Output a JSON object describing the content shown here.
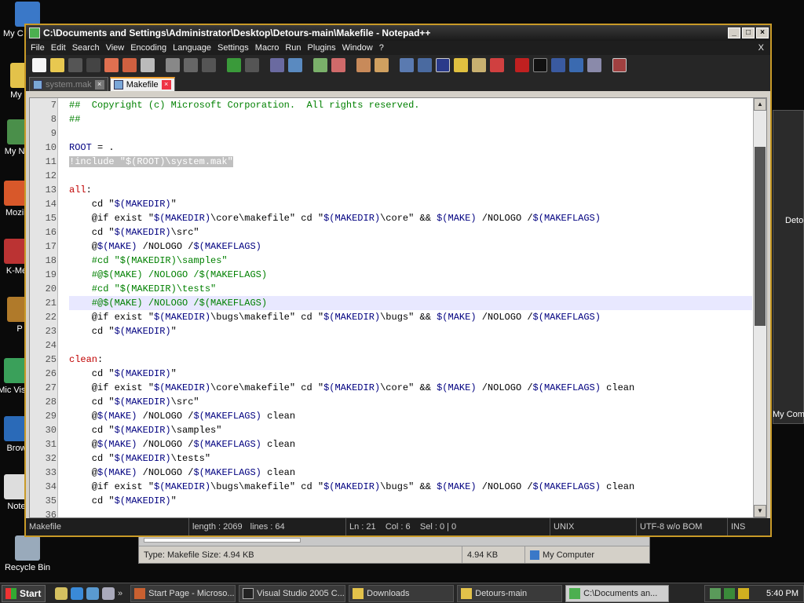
{
  "desktop": {
    "icons": [
      {
        "label": "My C"
      },
      {
        "label": "My Do"
      },
      {
        "label": "My N Pl"
      },
      {
        "label": "Mozill"
      },
      {
        "label": "K-Me"
      },
      {
        "label": "P"
      },
      {
        "label": "Mic Visua"
      },
      {
        "label": "Brow"
      },
      {
        "label": "Note"
      },
      {
        "label": "Recycle Bin"
      }
    ],
    "bg_right_labels": [
      "Deto",
      "My Comp"
    ]
  },
  "bg_explorer": {
    "status_type": "Type: Makefile Size: 4.94 KB",
    "status_size": "4.94 KB",
    "status_location": "My Computer"
  },
  "window": {
    "title": "C:\\Documents and Settings\\Administrator\\Desktop\\Detours-main\\Makefile - Notepad++",
    "controls": {
      "minimize": "_",
      "maximize": "□",
      "close": "×"
    }
  },
  "menu": [
    "File",
    "Edit",
    "Search",
    "View",
    "Encoding",
    "Language",
    "Settings",
    "Macro",
    "Run",
    "Plugins",
    "Window",
    "?"
  ],
  "menu_close": "X",
  "tabs": [
    {
      "label": "system.mak",
      "active": false
    },
    {
      "label": "Makefile",
      "active": true
    }
  ],
  "editor": {
    "lines": [
      {
        "n": "7",
        "parts": [
          {
            "c": "t-c",
            "t": "##  Copyright (c) Microsoft Corporation.  All rights reserved."
          }
        ]
      },
      {
        "n": "8",
        "parts": [
          {
            "c": "t-c",
            "t": "##"
          }
        ]
      },
      {
        "n": "9",
        "parts": []
      },
      {
        "n": "10",
        "parts": [
          {
            "c": "t-v",
            "t": "ROOT"
          },
          {
            "c": "t-d",
            "t": " = ."
          }
        ]
      },
      {
        "n": "11",
        "parts": [
          {
            "c": "t-sel",
            "t": "!include \"$(ROOT)\\system.mak\""
          }
        ]
      },
      {
        "n": "12",
        "parts": []
      },
      {
        "n": "13",
        "parts": [
          {
            "c": "t-k",
            "t": "all"
          },
          {
            "c": "t-d",
            "t": ":"
          }
        ]
      },
      {
        "n": "14",
        "parts": [
          {
            "c": "t-d",
            "t": "    cd \""
          },
          {
            "c": "t-v",
            "t": "$(MAKEDIR)"
          },
          {
            "c": "t-d",
            "t": "\""
          }
        ]
      },
      {
        "n": "15",
        "parts": [
          {
            "c": "t-d",
            "t": "    @if exist \""
          },
          {
            "c": "t-v",
            "t": "$(MAKEDIR)"
          },
          {
            "c": "t-d",
            "t": "\\core\\makefile\" cd \""
          },
          {
            "c": "t-v",
            "t": "$(MAKEDIR)"
          },
          {
            "c": "t-d",
            "t": "\\core\" && "
          },
          {
            "c": "t-v",
            "t": "$(MAKE)"
          },
          {
            "c": "t-d",
            "t": " /NOLOGO /"
          },
          {
            "c": "t-v",
            "t": "$(MAKEFLAGS)"
          }
        ]
      },
      {
        "n": "16",
        "parts": [
          {
            "c": "t-d",
            "t": "    cd \""
          },
          {
            "c": "t-v",
            "t": "$(MAKEDIR)"
          },
          {
            "c": "t-d",
            "t": "\\src\""
          }
        ]
      },
      {
        "n": "17",
        "parts": [
          {
            "c": "t-d",
            "t": "    @"
          },
          {
            "c": "t-v",
            "t": "$(MAKE)"
          },
          {
            "c": "t-d",
            "t": " /NOLOGO /"
          },
          {
            "c": "t-v",
            "t": "$(MAKEFLAGS)"
          }
        ]
      },
      {
        "n": "18",
        "parts": [
          {
            "c": "t-c",
            "t": "    #cd \"$(MAKEDIR)\\samples\""
          }
        ]
      },
      {
        "n": "19",
        "parts": [
          {
            "c": "t-c",
            "t": "    #@$(MAKE) /NOLOGO /$(MAKEFLAGS)"
          }
        ]
      },
      {
        "n": "20",
        "parts": [
          {
            "c": "t-c",
            "t": "    #cd \"$(MAKEDIR)\\tests\""
          }
        ]
      },
      {
        "n": "21",
        "cur": true,
        "parts": [
          {
            "c": "t-c",
            "t": "    #@$(MAKE) /NOLOGO /$(MAKEFLAGS)"
          }
        ]
      },
      {
        "n": "22",
        "parts": [
          {
            "c": "t-d",
            "t": "    @if exist \""
          },
          {
            "c": "t-v",
            "t": "$(MAKEDIR)"
          },
          {
            "c": "t-d",
            "t": "\\bugs\\makefile\" cd \""
          },
          {
            "c": "t-v",
            "t": "$(MAKEDIR)"
          },
          {
            "c": "t-d",
            "t": "\\bugs\" && "
          },
          {
            "c": "t-v",
            "t": "$(MAKE)"
          },
          {
            "c": "t-d",
            "t": " /NOLOGO /"
          },
          {
            "c": "t-v",
            "t": "$(MAKEFLAGS)"
          }
        ]
      },
      {
        "n": "23",
        "parts": [
          {
            "c": "t-d",
            "t": "    cd \""
          },
          {
            "c": "t-v",
            "t": "$(MAKEDIR)"
          },
          {
            "c": "t-d",
            "t": "\""
          }
        ]
      },
      {
        "n": "24",
        "parts": []
      },
      {
        "n": "25",
        "parts": [
          {
            "c": "t-k",
            "t": "clean"
          },
          {
            "c": "t-d",
            "t": ":"
          }
        ]
      },
      {
        "n": "26",
        "parts": [
          {
            "c": "t-d",
            "t": "    cd \""
          },
          {
            "c": "t-v",
            "t": "$(MAKEDIR)"
          },
          {
            "c": "t-d",
            "t": "\""
          }
        ]
      },
      {
        "n": "27",
        "parts": [
          {
            "c": "t-d",
            "t": "    @if exist \""
          },
          {
            "c": "t-v",
            "t": "$(MAKEDIR)"
          },
          {
            "c": "t-d",
            "t": "\\core\\makefile\" cd \""
          },
          {
            "c": "t-v",
            "t": "$(MAKEDIR)"
          },
          {
            "c": "t-d",
            "t": "\\core\" && "
          },
          {
            "c": "t-v",
            "t": "$(MAKE)"
          },
          {
            "c": "t-d",
            "t": " /NOLOGO /"
          },
          {
            "c": "t-v",
            "t": "$(MAKEFLAGS)"
          },
          {
            "c": "t-d",
            "t": " clean"
          }
        ]
      },
      {
        "n": "28",
        "parts": [
          {
            "c": "t-d",
            "t": "    cd \""
          },
          {
            "c": "t-v",
            "t": "$(MAKEDIR)"
          },
          {
            "c": "t-d",
            "t": "\\src\""
          }
        ]
      },
      {
        "n": "29",
        "parts": [
          {
            "c": "t-d",
            "t": "    @"
          },
          {
            "c": "t-v",
            "t": "$(MAKE)"
          },
          {
            "c": "t-d",
            "t": " /NOLOGO /"
          },
          {
            "c": "t-v",
            "t": "$(MAKEFLAGS)"
          },
          {
            "c": "t-d",
            "t": " clean"
          }
        ]
      },
      {
        "n": "30",
        "parts": [
          {
            "c": "t-d",
            "t": "    cd \""
          },
          {
            "c": "t-v",
            "t": "$(MAKEDIR)"
          },
          {
            "c": "t-d",
            "t": "\\samples\""
          }
        ]
      },
      {
        "n": "31",
        "parts": [
          {
            "c": "t-d",
            "t": "    @"
          },
          {
            "c": "t-v",
            "t": "$(MAKE)"
          },
          {
            "c": "t-d",
            "t": " /NOLOGO /"
          },
          {
            "c": "t-v",
            "t": "$(MAKEFLAGS)"
          },
          {
            "c": "t-d",
            "t": " clean"
          }
        ]
      },
      {
        "n": "32",
        "parts": [
          {
            "c": "t-d",
            "t": "    cd \""
          },
          {
            "c": "t-v",
            "t": "$(MAKEDIR)"
          },
          {
            "c": "t-d",
            "t": "\\tests\""
          }
        ]
      },
      {
        "n": "33",
        "parts": [
          {
            "c": "t-d",
            "t": "    @"
          },
          {
            "c": "t-v",
            "t": "$(MAKE)"
          },
          {
            "c": "t-d",
            "t": " /NOLOGO /"
          },
          {
            "c": "t-v",
            "t": "$(MAKEFLAGS)"
          },
          {
            "c": "t-d",
            "t": " clean"
          }
        ]
      },
      {
        "n": "34",
        "parts": [
          {
            "c": "t-d",
            "t": "    @if exist \""
          },
          {
            "c": "t-v",
            "t": "$(MAKEDIR)"
          },
          {
            "c": "t-d",
            "t": "\\bugs\\makefile\" cd \""
          },
          {
            "c": "t-v",
            "t": "$(MAKEDIR)"
          },
          {
            "c": "t-d",
            "t": "\\bugs\" && "
          },
          {
            "c": "t-v",
            "t": "$(MAKE)"
          },
          {
            "c": "t-d",
            "t": " /NOLOGO /"
          },
          {
            "c": "t-v",
            "t": "$(MAKEFLAGS)"
          },
          {
            "c": "t-d",
            "t": " clean"
          }
        ]
      },
      {
        "n": "35",
        "parts": [
          {
            "c": "t-d",
            "t": "    cd \""
          },
          {
            "c": "t-v",
            "t": "$(MAKEDIR)"
          },
          {
            "c": "t-d",
            "t": "\""
          }
        ]
      },
      {
        "n": "36",
        "parts": []
      }
    ]
  },
  "status": {
    "file_type": "Makefile",
    "length": "length : 2069",
    "lines": "lines : 64",
    "position": "Ln : 21    Col : 6    Sel : 0 | 0",
    "eol": "UNIX",
    "encoding": "UTF-8 w/o BOM",
    "mode": "INS"
  },
  "taskbar": {
    "start_label": "Start",
    "quicklaunch_more": "»",
    "tasks": [
      {
        "label": "Start Page - Microso...",
        "active": false
      },
      {
        "label": "Visual Studio 2005 C...",
        "active": false
      },
      {
        "label": "Downloads",
        "active": false
      },
      {
        "label": "Detours-main",
        "active": false
      },
      {
        "label": "C:\\Documents an...",
        "active": true
      }
    ],
    "clock": "5:40 PM"
  },
  "colors": {
    "comment": "#008000",
    "keyword": "#c00000",
    "variable": "#000080",
    "accent": "#c89a28"
  }
}
